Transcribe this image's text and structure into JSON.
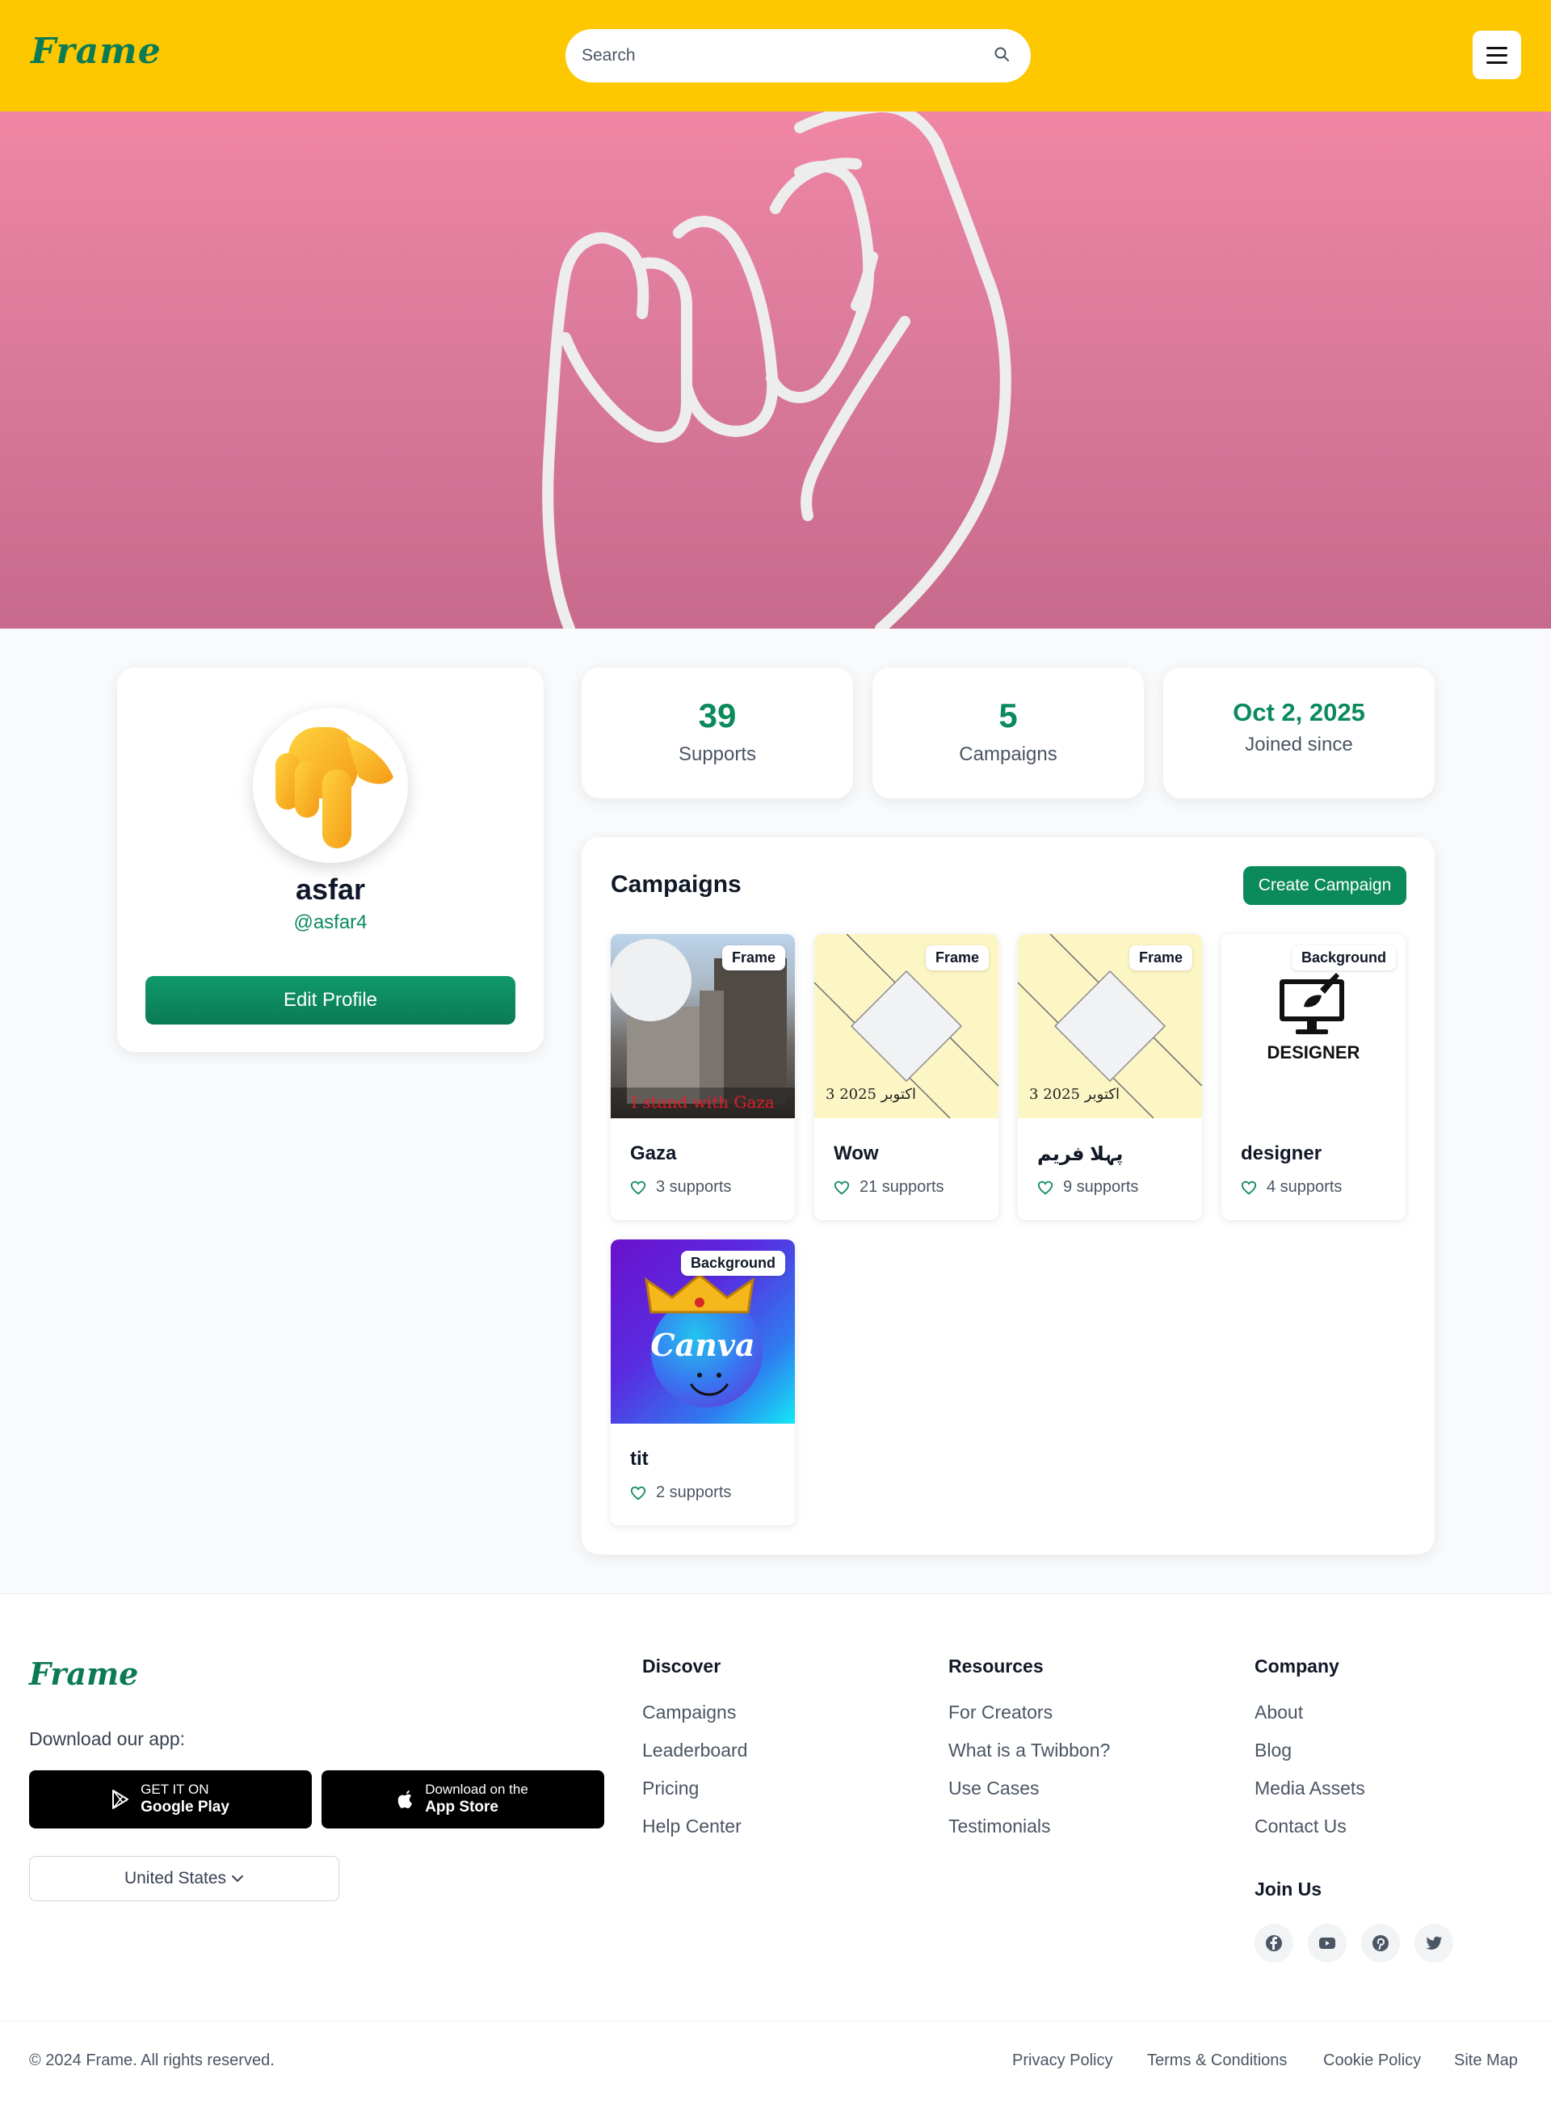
{
  "header": {
    "logo": "Frame",
    "search_placeholder": "Search"
  },
  "profile": {
    "name": "asfar",
    "handle": "@asfar4",
    "edit_label": "Edit Profile"
  },
  "stats": [
    {
      "value": "39",
      "label": "Supports"
    },
    {
      "value": "5",
      "label": "Campaigns"
    },
    {
      "value": "Oct 2, 2025",
      "label": "Joined since"
    }
  ],
  "campaigns": {
    "title": "Campaigns",
    "create_label": "Create Campaign",
    "items": [
      {
        "name": "Gaza",
        "badge": "Frame",
        "supports": "3 supports",
        "thumb_text": "I stand with Gaza"
      },
      {
        "name": "Wow",
        "badge": "Frame",
        "supports": "21 supports",
        "thumb_text": "3 اکتوبر 2025"
      },
      {
        "name": "پہلا فریم",
        "badge": "Frame",
        "supports": "9 supports",
        "thumb_text": "3 اکتوبر 2025"
      },
      {
        "name": "designer",
        "badge": "Background",
        "supports": "4 supports",
        "thumb_text": "DESIGNER"
      },
      {
        "name": "tit",
        "badge": "Background",
        "supports": "2 supports",
        "thumb_text": "Canva"
      }
    ]
  },
  "footer": {
    "logo": "Frame",
    "download_label": "Download our app:",
    "google_play": {
      "small": "GET IT ON",
      "big": "Google Play"
    },
    "app_store": {
      "small": "Download on the",
      "big": "App Store"
    },
    "country": "United States",
    "columns": [
      {
        "heading": "Discover",
        "links": [
          "Campaigns",
          "Leaderboard",
          "Pricing",
          "Help Center"
        ]
      },
      {
        "heading": "Resources",
        "links": [
          "For Creators",
          "What is a Twibbon?",
          "Use Cases",
          "Testimonials"
        ]
      },
      {
        "heading": "Company",
        "links": [
          "About",
          "Blog",
          "Media Assets",
          "Contact Us"
        ]
      }
    ],
    "join_heading": "Join Us",
    "social": [
      "facebook-icon",
      "youtube-icon",
      "pinterest-icon",
      "twitter-icon"
    ],
    "copyright": "© 2024 Frame. All rights reserved.",
    "legal": [
      "Privacy Policy",
      "Terms & Conditions",
      "Cookie Policy",
      "Site Map"
    ]
  },
  "colors": {
    "header": "#fdc800",
    "accent": "#0b8a5c",
    "banner": "#e27f9f"
  }
}
